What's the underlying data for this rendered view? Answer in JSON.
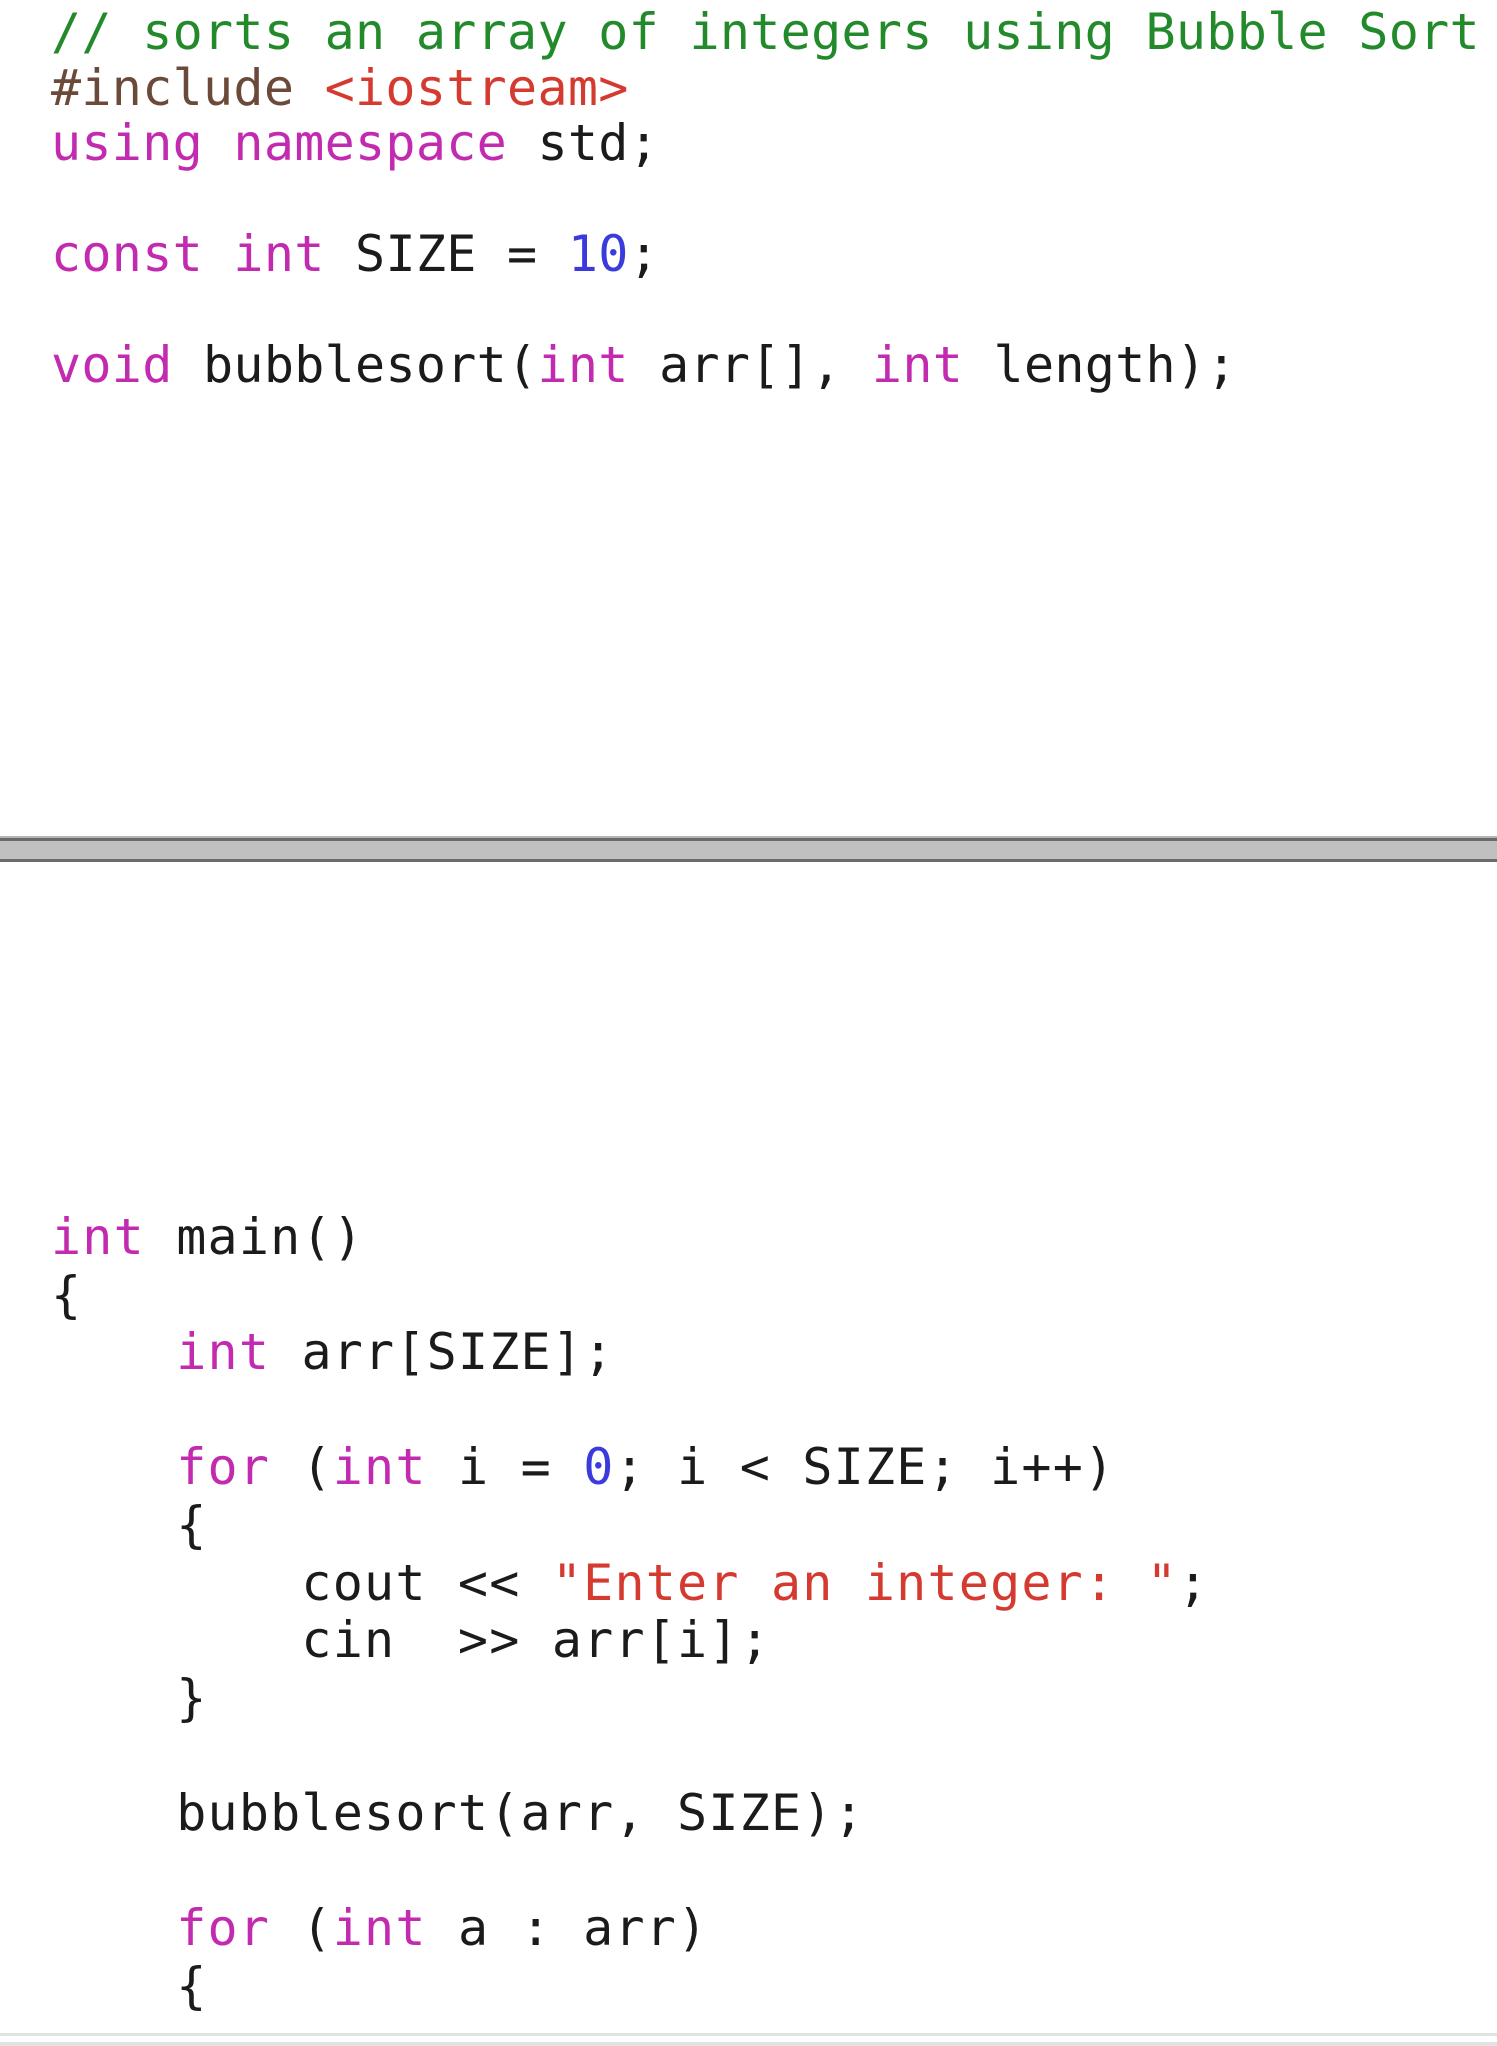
{
  "editor": {
    "top_pane": {
      "lines": [
        [
          {
            "t": "// sorts an array of integers using Bubble Sort",
            "k": "comment"
          }
        ],
        [
          {
            "t": "#include ",
            "k": "preproc"
          },
          {
            "t": "<iostream>",
            "k": "string"
          }
        ],
        [
          {
            "t": "using",
            "k": "keyword"
          },
          {
            "t": " ",
            "k": "plain"
          },
          {
            "t": "namespace",
            "k": "keyword"
          },
          {
            "t": " std;",
            "k": "plain"
          }
        ],
        [],
        [
          {
            "t": "const",
            "k": "keyword"
          },
          {
            "t": " ",
            "k": "plain"
          },
          {
            "t": "int",
            "k": "keyword"
          },
          {
            "t": " SIZE = ",
            "k": "plain"
          },
          {
            "t": "10",
            "k": "number"
          },
          {
            "t": ";",
            "k": "plain"
          }
        ],
        [],
        [
          {
            "t": "void",
            "k": "keyword"
          },
          {
            "t": " bubblesort(",
            "k": "plain"
          },
          {
            "t": "int",
            "k": "keyword"
          },
          {
            "t": " arr[], ",
            "k": "plain"
          },
          {
            "t": "int",
            "k": "keyword"
          },
          {
            "t": " length);",
            "k": "plain"
          }
        ]
      ]
    },
    "bottom_pane": {
      "lines": [
        [
          {
            "t": "int",
            "k": "keyword"
          },
          {
            "t": " main()",
            "k": "plain"
          }
        ],
        [
          {
            "t": "{",
            "k": "plain"
          }
        ],
        [
          {
            "t": "    ",
            "k": "plain"
          },
          {
            "t": "int",
            "k": "keyword"
          },
          {
            "t": " arr[SIZE];",
            "k": "plain"
          }
        ],
        [],
        [
          {
            "t": "    ",
            "k": "plain"
          },
          {
            "t": "for",
            "k": "keyword"
          },
          {
            "t": " (",
            "k": "plain"
          },
          {
            "t": "int",
            "k": "keyword"
          },
          {
            "t": " i = ",
            "k": "plain"
          },
          {
            "t": "0",
            "k": "number"
          },
          {
            "t": "; i < SIZE; i++)",
            "k": "plain"
          }
        ],
        [
          {
            "t": "    {",
            "k": "plain"
          }
        ],
        [
          {
            "t": "        cout << ",
            "k": "plain"
          },
          {
            "t": "\"Enter an integer: \"",
            "k": "string"
          },
          {
            "t": ";",
            "k": "plain"
          }
        ],
        [
          {
            "t": "        cin  >> arr[i];",
            "k": "plain"
          }
        ],
        [
          {
            "t": "    }",
            "k": "plain"
          }
        ],
        [],
        [
          {
            "t": "    bubblesort(arr, SIZE);",
            "k": "plain"
          }
        ],
        [],
        [
          {
            "t": "    ",
            "k": "plain"
          },
          {
            "t": "for",
            "k": "keyword"
          },
          {
            "t": " (",
            "k": "plain"
          },
          {
            "t": "int",
            "k": "keyword"
          },
          {
            "t": " a : arr)",
            "k": "plain"
          }
        ],
        [
          {
            "t": "    {",
            "k": "plain"
          }
        ]
      ]
    },
    "colors": {
      "comment": "#238a2b",
      "keyword": "#c22bb0",
      "number": "#3b3bdd",
      "string": "#d43a2f",
      "preproc": "#6b4a3a",
      "plain": "#1b1b1b",
      "splitter": "#c0c0c0"
    }
  }
}
